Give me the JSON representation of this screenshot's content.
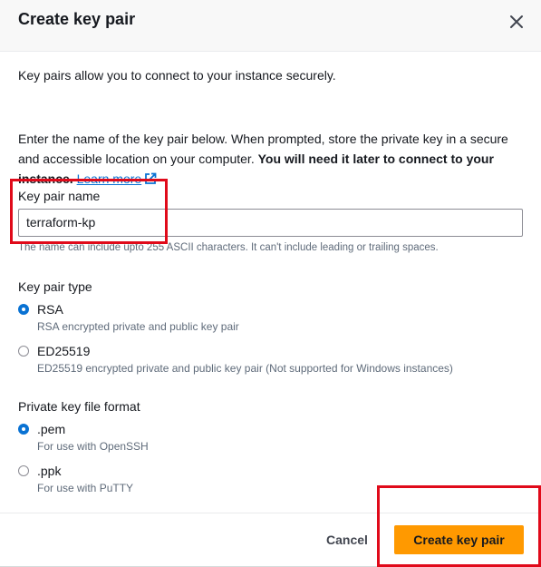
{
  "header": {
    "title": "Create key pair",
    "close_icon": "close-icon"
  },
  "intro": {
    "line1": "Key pairs allow you to connect to your instance securely.",
    "line2": "Enter the name of the key pair below. When prompted, store the private key in a secure and accessible location on your computer. ",
    "line2_bold": "You will need it later to connect to your instance.",
    "learn_more": "Learn more",
    "learn_more_icon": "external-link-icon"
  },
  "key_name": {
    "label": "Key pair name",
    "value": "terraform-kp",
    "hint": "The name can include upto 255 ASCII characters. It can't include leading or trailing spaces."
  },
  "key_type": {
    "label": "Key pair type",
    "options": [
      {
        "label": "RSA",
        "description": "RSA encrypted private and public key pair",
        "selected": true
      },
      {
        "label": "ED25519",
        "description": "ED25519 encrypted private and public key pair (Not supported for Windows instances)",
        "selected": false
      }
    ]
  },
  "file_format": {
    "label": "Private key file format",
    "options": [
      {
        "label": ".pem",
        "description": "For use with OpenSSH",
        "selected": true
      },
      {
        "label": ".ppk",
        "description": "For use with PuTTY",
        "selected": false
      }
    ]
  },
  "footer": {
    "cancel_label": "Cancel",
    "create_label": "Create key pair"
  },
  "colors": {
    "primary_button": "#ff9900",
    "link": "#0972d3",
    "highlight_box": "#e00a1a"
  }
}
